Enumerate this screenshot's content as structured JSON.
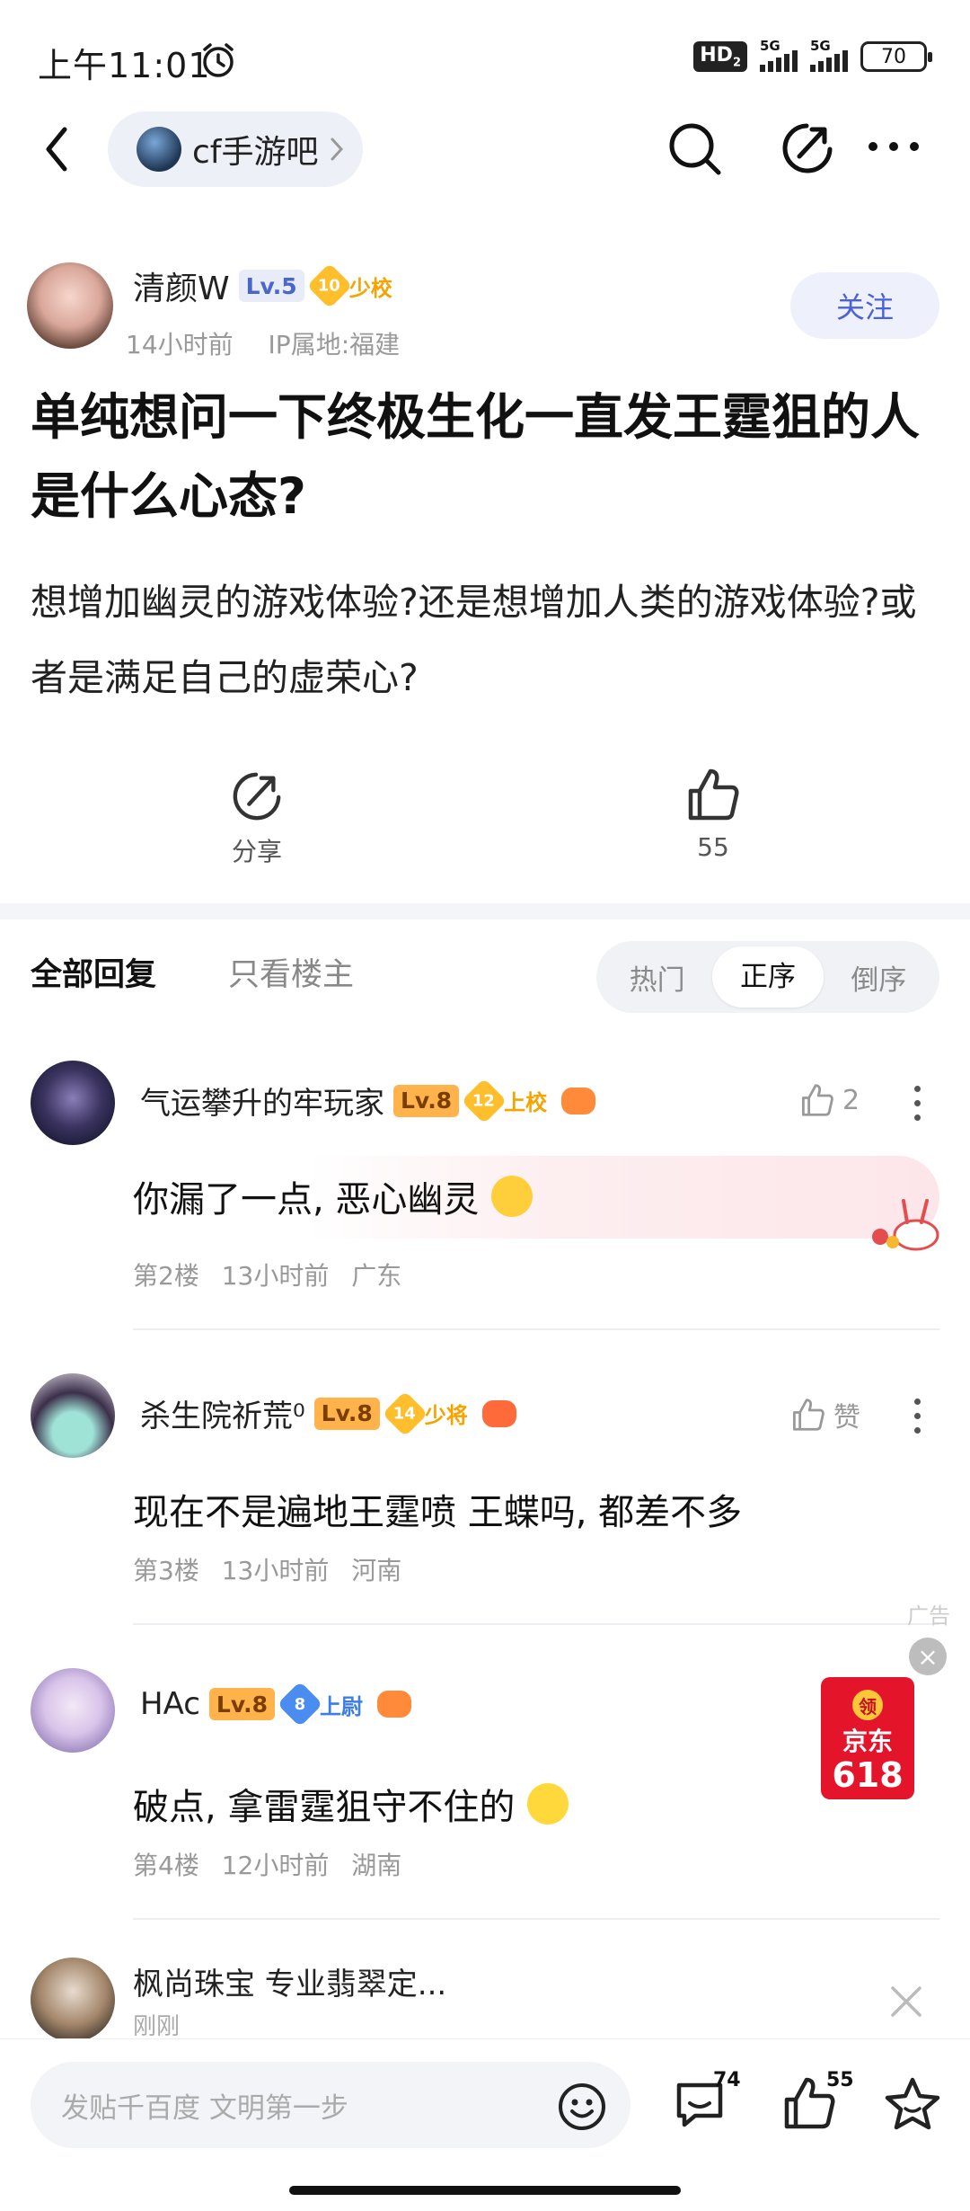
{
  "status_bar": {
    "time": "上午11:01",
    "hd": "HD",
    "hd_sub": "2",
    "net1": "5G",
    "net2": "5G",
    "battery": "70"
  },
  "header": {
    "forum_name": "cf手游吧"
  },
  "post": {
    "author": "清颜W",
    "level": "Lv.5",
    "medal_num": "10",
    "medal_title": "少校",
    "time": "14小时前",
    "ip": "IP属地:福建",
    "follow_label": "关注",
    "title": "单纯想问一下终极生化一直发王霆狙的人是什么心态?",
    "body": "想增加幽灵的游戏体验?还是想增加人类的游戏体验?或者是满足自己的虚荣心?",
    "share_label": "分享",
    "like_count": "55"
  },
  "reply_tabs": {
    "all": "全部回复",
    "op_only": "只看楼主",
    "sort": [
      "热门",
      "正序",
      "倒序"
    ],
    "active_sort": "正序"
  },
  "comments": [
    {
      "name": "气运攀升的牢玩家",
      "level": "Lv.8",
      "medal_num": "12",
      "medal_title": "上校",
      "text": "你漏了一点, 恶心幽灵",
      "floor": "第2楼",
      "time": "13小时前",
      "location": "广东",
      "likes": "2"
    },
    {
      "name": "杀生院祈荒⁰",
      "level": "Lv.8",
      "medal_num": "14",
      "medal_title": "少将",
      "text": "现在不是遍地王霆喷 王蝶吗, 都差不多",
      "floor": "第3楼",
      "time": "13小时前",
      "location": "河南",
      "likes": "赞"
    },
    {
      "name": "HAc",
      "level": "Lv.8",
      "medal_num": "8",
      "medal_title": "上尉",
      "text": "破点, 拿雷霆狙守不住的",
      "floor": "第4楼",
      "time": "12小时前",
      "location": "湖南"
    }
  ],
  "ad": {
    "label": "广告",
    "jd_top": "领",
    "jd_brand": "京东",
    "jd_num": "618"
  },
  "notification": {
    "title": "枫尚珠宝 专业翡翠定...",
    "time": "刚刚"
  },
  "bottom_bar": {
    "input_placeholder": "发贴千百度 文明第一步",
    "comment_count": "74",
    "like_count": "55"
  }
}
